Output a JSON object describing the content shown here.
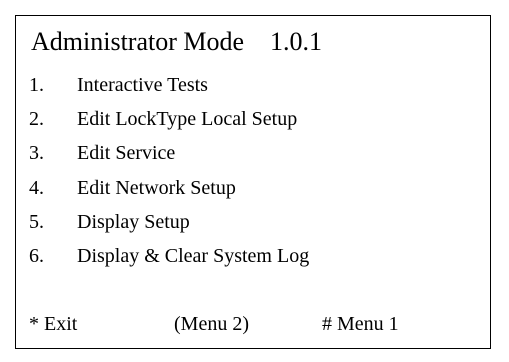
{
  "screen": {
    "title": "Administrator Mode",
    "version": "1.0.1"
  },
  "menu": {
    "items": [
      {
        "number": "1.",
        "label": "Interactive Tests"
      },
      {
        "number": "2.",
        "label": "Edit LockType Local Setup"
      },
      {
        "number": "3.",
        "label": "Edit Service"
      },
      {
        "number": "4.",
        "label": "Edit Network Setup"
      },
      {
        "number": "5.",
        "label": "Display Setup"
      },
      {
        "number": "6.",
        "label": "Display & Clear System Log"
      }
    ]
  },
  "footer": {
    "exit": "* Exit",
    "menu2": "(Menu 2)",
    "menu1": "# Menu 1"
  }
}
